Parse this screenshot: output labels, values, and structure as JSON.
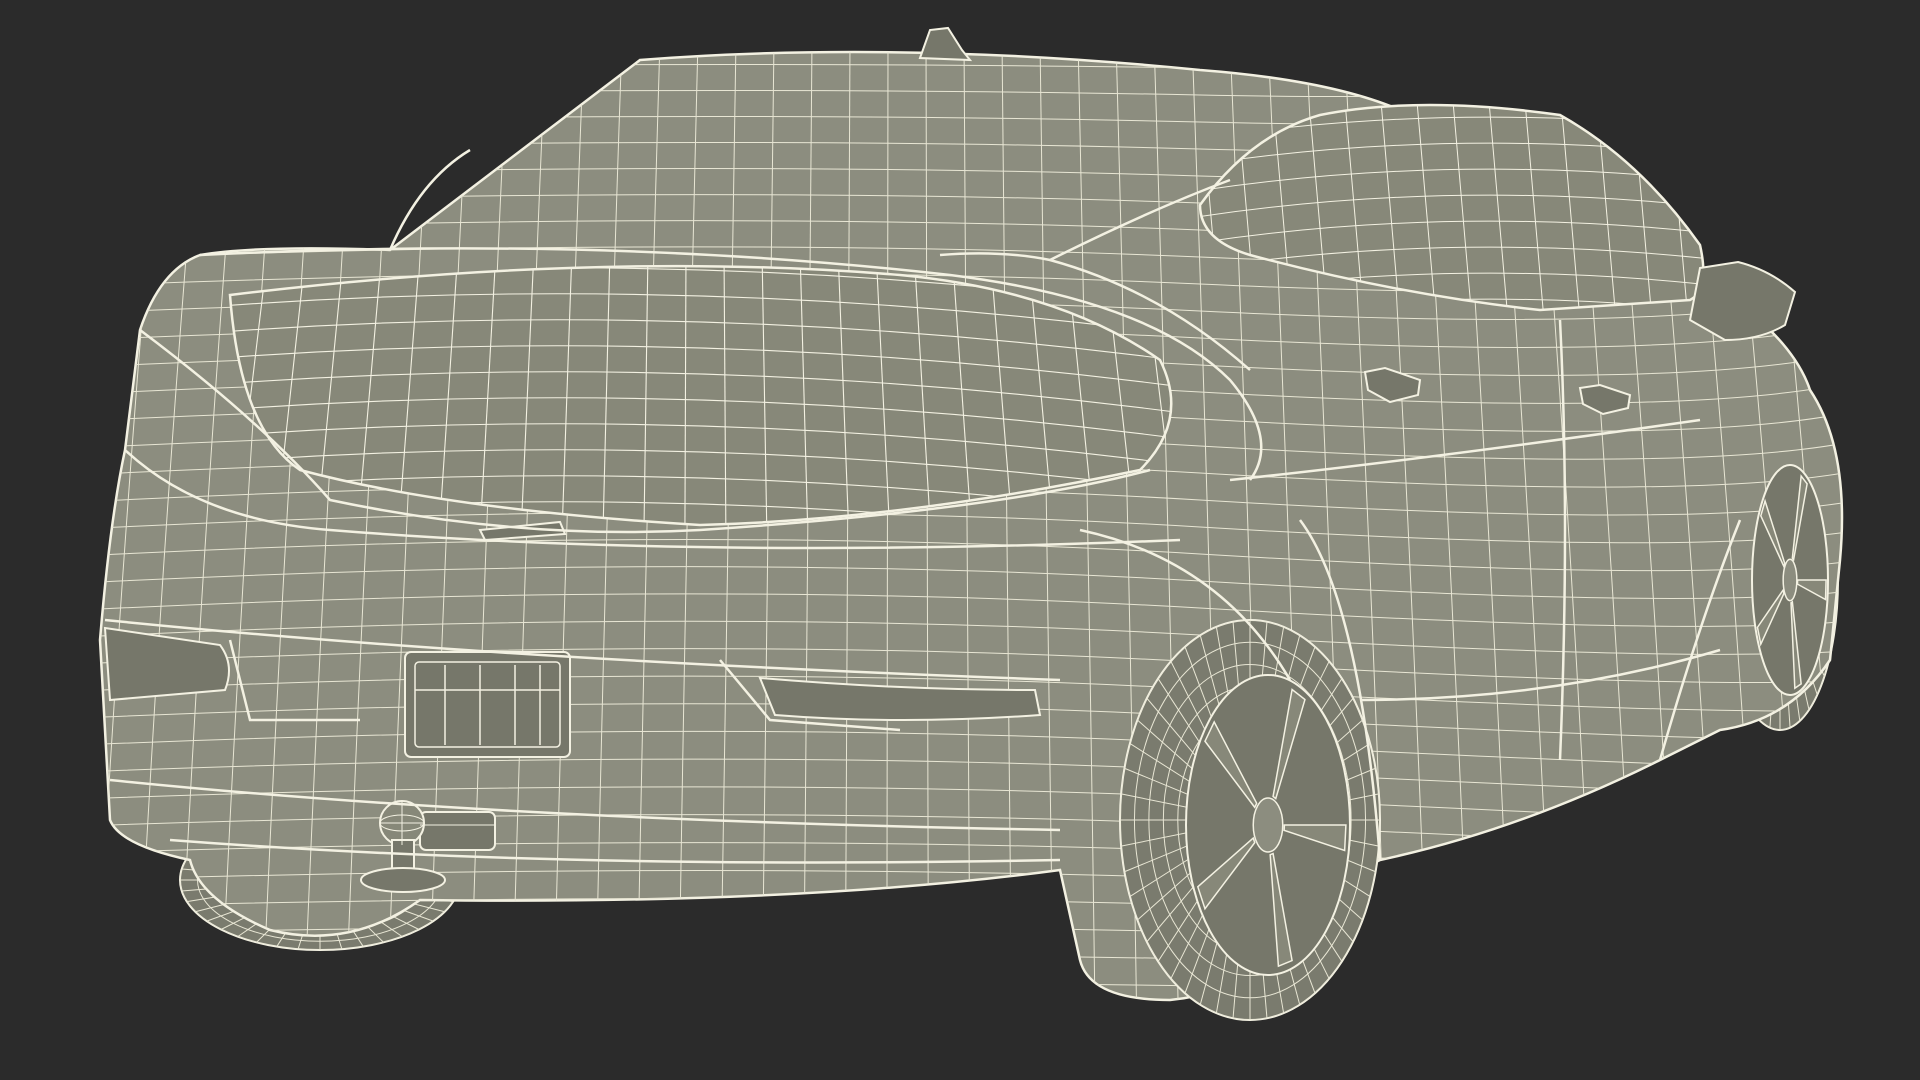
{
  "scene": {
    "subject": "car-3d-wireframe-rear-view",
    "colors": {
      "background": "#2b2b2b",
      "body_fill": "#8c8d7f",
      "body_shade": "#76776a",
      "glass_fill": "#878879",
      "tire_fill": "#7a7b6e",
      "wire_stroke": "#f3f1e2",
      "wire_minor": "#e8e6d4"
    }
  }
}
